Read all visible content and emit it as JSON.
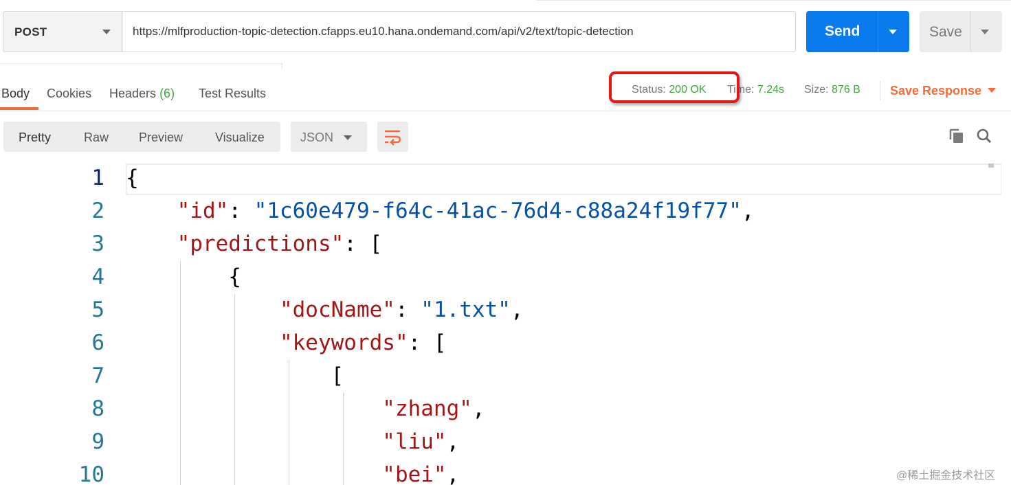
{
  "request": {
    "method": "POST",
    "url": "https://mlfproduction-topic-detection.cfapps.eu10.hana.ondemand.com/api/v2/text/topic-detection",
    "send_label": "Send",
    "save_label": "Save"
  },
  "response_tabs": {
    "body": "Body",
    "cookies": "Cookies",
    "headers": "Headers",
    "headers_count": "(6)",
    "test_results": "Test Results"
  },
  "response_meta": {
    "status_label": "Status:",
    "status_value": "200 OK",
    "time_label": "Time:",
    "time_value": "7.24s",
    "size_label": "Size:",
    "size_value": "876 B",
    "save_response": "Save Response"
  },
  "format_bar": {
    "views": [
      "Pretty",
      "Raw",
      "Preview",
      "Visualize"
    ],
    "language": "JSON",
    "wrap_icon": "wrap-lines-icon",
    "copy_icon": "copy-icon",
    "search_icon": "search-icon"
  },
  "code": {
    "line_numbers": [
      "1",
      "2",
      "3",
      "4",
      "5",
      "6",
      "7",
      "8",
      "9",
      "10"
    ],
    "lines": [
      [
        {
          "t": "p",
          "v": "{"
        }
      ],
      [
        {
          "t": "p",
          "v": "    "
        },
        {
          "t": "key",
          "v": "\"id\""
        },
        {
          "t": "p",
          "v": ": "
        },
        {
          "t": "str",
          "v": "\"1c60e479-f64c-41ac-76d4-c88a24f19f77\""
        },
        {
          "t": "p",
          "v": ","
        }
      ],
      [
        {
          "t": "p",
          "v": "    "
        },
        {
          "t": "key",
          "v": "\"predictions\""
        },
        {
          "t": "p",
          "v": ": ["
        }
      ],
      [
        {
          "t": "p",
          "v": "        {"
        }
      ],
      [
        {
          "t": "p",
          "v": "            "
        },
        {
          "t": "key",
          "v": "\"docName\""
        },
        {
          "t": "p",
          "v": ": "
        },
        {
          "t": "str",
          "v": "\"1.txt\""
        },
        {
          "t": "p",
          "v": ","
        }
      ],
      [
        {
          "t": "p",
          "v": "            "
        },
        {
          "t": "key",
          "v": "\"keywords\""
        },
        {
          "t": "p",
          "v": ": ["
        }
      ],
      [
        {
          "t": "p",
          "v": "                ["
        }
      ],
      [
        {
          "t": "p",
          "v": "                    "
        },
        {
          "t": "key",
          "v": "\"zhang\""
        },
        {
          "t": "p",
          "v": ","
        }
      ],
      [
        {
          "t": "p",
          "v": "                    "
        },
        {
          "t": "key",
          "v": "\"liu\""
        },
        {
          "t": "p",
          "v": ","
        }
      ],
      [
        {
          "t": "p",
          "v": "                    "
        },
        {
          "t": "key",
          "v": "\"bei\""
        },
        {
          "t": "p",
          "v": ","
        }
      ]
    ]
  },
  "watermark": "@稀土掘金技术社区",
  "colors": {
    "accent_orange": "#f26b3a",
    "send_blue": "#097bed",
    "status_green": "#3fa63f",
    "highlight_red": "#e01818"
  }
}
